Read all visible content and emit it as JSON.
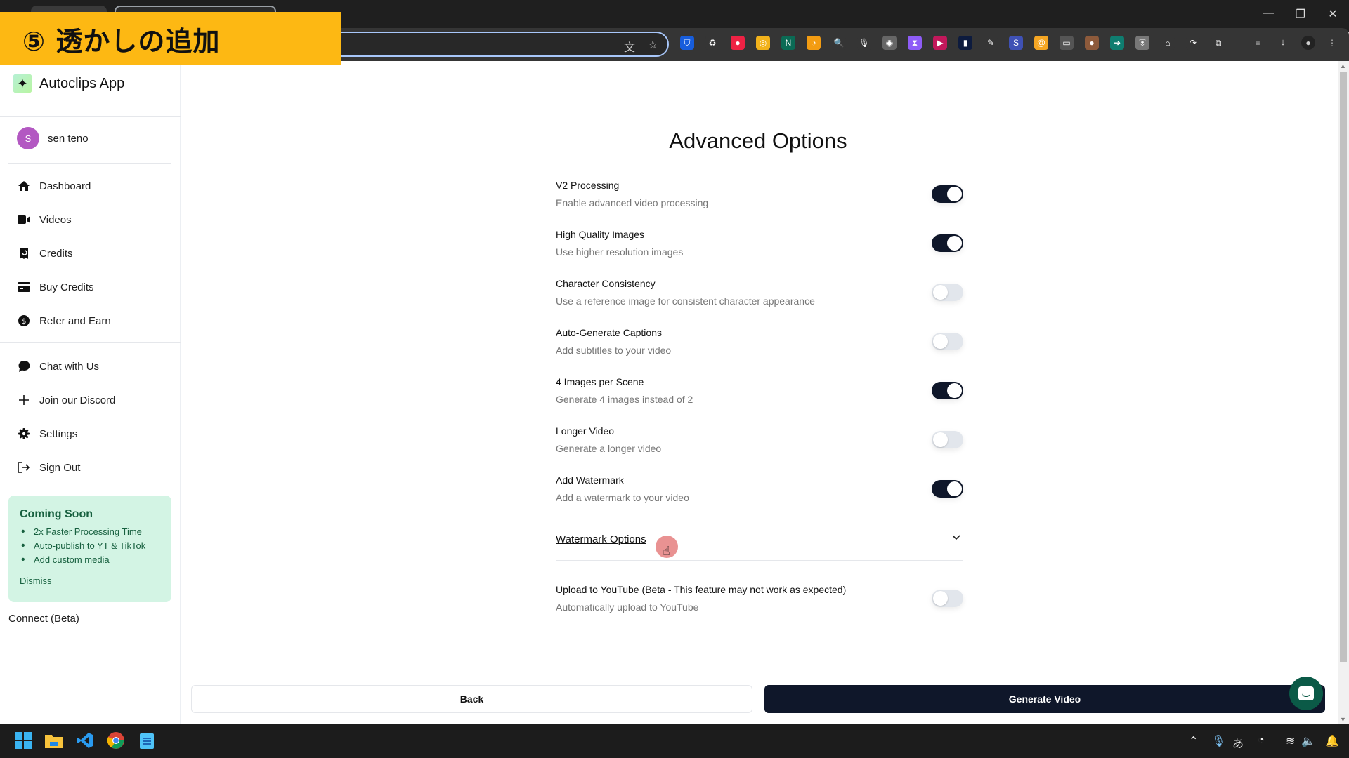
{
  "banner": {
    "text": "⑤ 透かしの追加"
  },
  "browser": {
    "window_controls": {
      "minimize": "—",
      "restore": "❐",
      "close": "✕"
    },
    "extensions": [
      {
        "name": "bitwarden",
        "color": "#175ddc",
        "glyph": "⛉"
      },
      {
        "name": "recycle",
        "color": "#353535",
        "glyph": "♻"
      },
      {
        "name": "color-picker",
        "color": "#e24",
        "glyph": "●"
      },
      {
        "name": "coin",
        "color": "#f2b21b",
        "glyph": "◎"
      },
      {
        "name": "notion-n",
        "color": "#0b6b55",
        "glyph": "N"
      },
      {
        "name": "speedometer",
        "color": "#f39c12",
        "glyph": "◔"
      },
      {
        "name": "magnifier",
        "color": "#353535",
        "glyph": "🔍"
      },
      {
        "name": "microphone",
        "color": "#353535",
        "glyph": "🎙"
      },
      {
        "name": "robot",
        "color": "#666",
        "glyph": "◉"
      },
      {
        "name": "hourglass",
        "color": "#8e5cf7",
        "glyph": "⧗"
      },
      {
        "name": "play",
        "color": "#c2185b",
        "glyph": "▶"
      },
      {
        "name": "bookmark",
        "color": "#0d1b3e",
        "glyph": "▮"
      },
      {
        "name": "pen",
        "color": "#353535",
        "glyph": "✎"
      },
      {
        "name": "s-box",
        "color": "#3f51b5",
        "glyph": "S"
      },
      {
        "name": "spiral",
        "color": "#f5a623",
        "glyph": "@"
      },
      {
        "name": "tablet",
        "color": "#555",
        "glyph": "▭"
      },
      {
        "name": "cookie",
        "color": "#8d5a3b",
        "glyph": "●"
      },
      {
        "name": "arrow-right",
        "color": "#0f7d70",
        "glyph": "➔"
      },
      {
        "name": "shield",
        "color": "#777",
        "glyph": "⛨"
      },
      {
        "name": "mouse",
        "color": "#353535",
        "glyph": "⌂"
      },
      {
        "name": "share-arrow",
        "color": "#353535",
        "glyph": "↷"
      },
      {
        "name": "puzzle",
        "color": "#353535",
        "glyph": "⧉"
      }
    ]
  },
  "sidebar": {
    "app_name": "Autoclips App",
    "user": {
      "initial": "S",
      "name": "sen teno"
    },
    "nav": [
      {
        "label": "Dashboard",
        "icon": "home"
      },
      {
        "label": "Videos",
        "icon": "video"
      },
      {
        "label": "Credits",
        "icon": "receipt"
      },
      {
        "label": "Buy Credits",
        "icon": "credit-card"
      },
      {
        "label": "Refer and Earn",
        "icon": "dollar"
      }
    ],
    "nav2": [
      {
        "label": "Chat with Us",
        "icon": "chat"
      },
      {
        "label": "Join our Discord",
        "icon": "plus"
      },
      {
        "label": "Settings",
        "icon": "gear"
      },
      {
        "label": "Sign Out",
        "icon": "sign-out"
      }
    ],
    "coming_soon": {
      "title": "Coming Soon",
      "items": [
        "2x Faster Processing Time",
        "Auto-publish to YT & TikTok",
        "Add custom media"
      ],
      "dismiss": "Dismiss"
    },
    "connect": "Connect (Beta)"
  },
  "main": {
    "title": "Advanced Options",
    "options": [
      {
        "label": "V2 Processing",
        "desc": "Enable advanced video processing",
        "enabled": true
      },
      {
        "label": "High Quality Images",
        "desc": "Use higher resolution images",
        "enabled": true
      },
      {
        "label": "Character Consistency",
        "desc": "Use a reference image for consistent character appearance",
        "enabled": false
      },
      {
        "label": "Auto-Generate Captions",
        "desc": "Add subtitles to your video",
        "enabled": false
      },
      {
        "label": "4 Images per Scene",
        "desc": "Generate 4 images instead of 2",
        "enabled": true
      },
      {
        "label": "Longer Video",
        "desc": "Generate a longer video",
        "enabled": false
      },
      {
        "label": "Add Watermark",
        "desc": "Add a watermark to your video",
        "enabled": true
      }
    ],
    "watermark_options": "Watermark Options",
    "youtube": {
      "label": "Upload to YouTube (Beta - This feature may not work as expected)",
      "desc": "Automatically upload to YouTube",
      "enabled": false
    },
    "back_label": "Back",
    "generate_label": "Generate Video"
  },
  "colors": {
    "accent": "#0f172a",
    "banner": "#fdb813",
    "coming_soon_bg": "#d3f4e4",
    "chat_bubble": "#0b5a47"
  }
}
